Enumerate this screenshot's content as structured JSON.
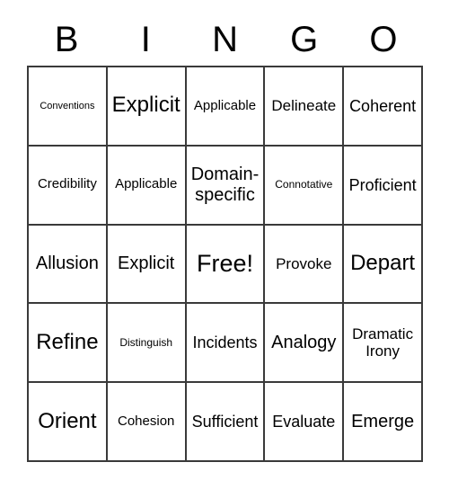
{
  "card": {
    "header_letters": [
      "B",
      "I",
      "N",
      "G",
      "O"
    ],
    "columns": 5,
    "rows": 5,
    "free_space_label": "Free!",
    "colors": {
      "background": "#ffffff",
      "text": "#000000",
      "border": "#3a3a3a"
    },
    "cells": [
      [
        {
          "text": "Conventions",
          "size": "fs-xs"
        },
        {
          "text": "Explicit",
          "size": "fs-3xl"
        },
        {
          "text": "Applicable",
          "size": "fs-md"
        },
        {
          "text": "Delineate",
          "size": "fs-lg"
        },
        {
          "text": "Coherent",
          "size": "fs-xl"
        }
      ],
      [
        {
          "text": "Credibility",
          "size": "fs-md"
        },
        {
          "text": "Applicable",
          "size": "fs-md"
        },
        {
          "text": "Domain-specific",
          "size": "fs-2xl"
        },
        {
          "text": "Connotative",
          "size": "fs-sm"
        },
        {
          "text": "Proficient",
          "size": "fs-xl"
        }
      ],
      [
        {
          "text": "Allusion",
          "size": "fs-2xl"
        },
        {
          "text": "Explicit",
          "size": "fs-2xl"
        },
        {
          "text": "Free!",
          "size": "fs-free"
        },
        {
          "text": "Provoke",
          "size": "fs-lg"
        },
        {
          "text": "Depart",
          "size": "fs-3xl"
        }
      ],
      [
        {
          "text": "Refine",
          "size": "fs-3xl"
        },
        {
          "text": "Distinguish",
          "size": "fs-sm"
        },
        {
          "text": "Incidents",
          "size": "fs-xl"
        },
        {
          "text": "Analogy",
          "size": "fs-2xl"
        },
        {
          "text": "Dramatic Irony",
          "size": "fs-lg"
        }
      ],
      [
        {
          "text": "Orient",
          "size": "fs-3xl"
        },
        {
          "text": "Cohesion",
          "size": "fs-md"
        },
        {
          "text": "Sufficient",
          "size": "fs-xl"
        },
        {
          "text": "Evaluate",
          "size": "fs-xl"
        },
        {
          "text": "Emerge",
          "size": "fs-2xl"
        }
      ]
    ]
  }
}
